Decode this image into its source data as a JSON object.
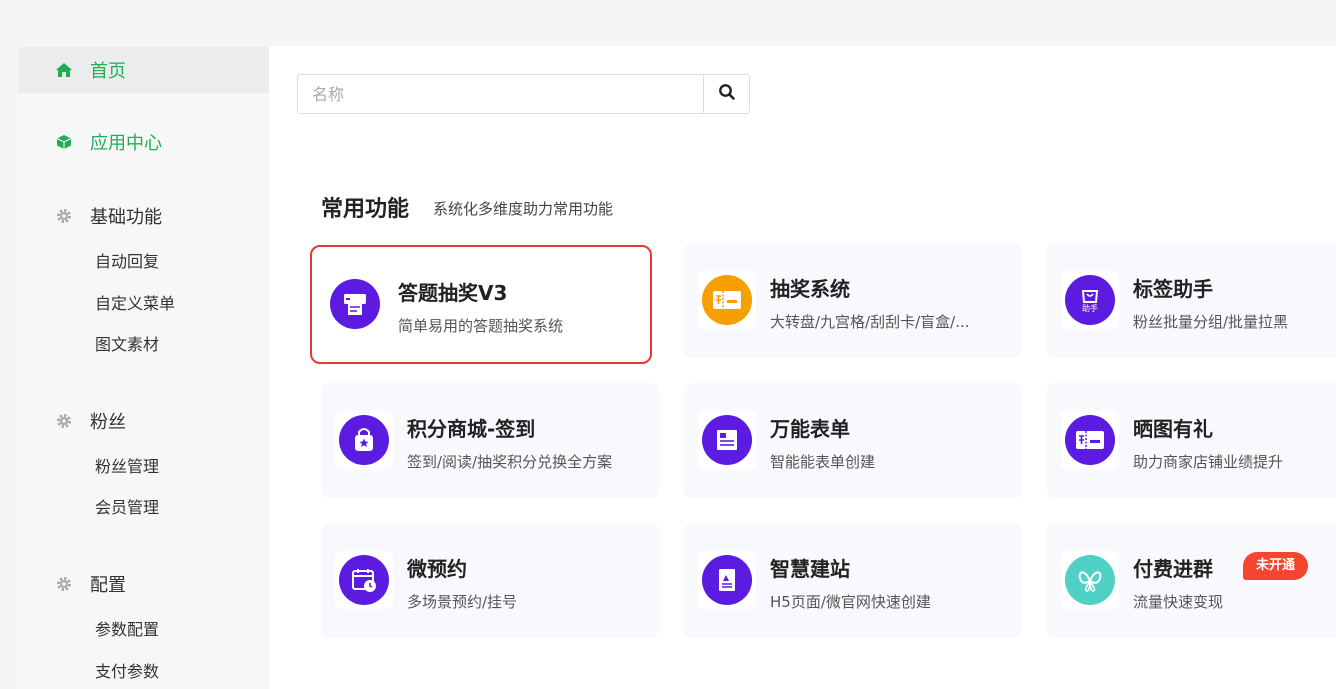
{
  "sidebar": {
    "home": {
      "label": "首页",
      "icon": "home-icon"
    },
    "app_center": {
      "label": "应用中心",
      "icon": "cube-icon"
    },
    "groups": [
      {
        "label": "基础功能",
        "icon": "gear-icon",
        "items": [
          "自动回复",
          "自定义菜单",
          "图文素材"
        ]
      },
      {
        "label": "粉丝",
        "icon": "gear-icon",
        "items": [
          "粉丝管理",
          "会员管理"
        ]
      },
      {
        "label": "配置",
        "icon": "gear-icon",
        "items": [
          "参数配置",
          "支付参数"
        ]
      }
    ]
  },
  "search": {
    "placeholder": "名称",
    "value": ""
  },
  "section": {
    "title": "常用功能",
    "subtitle": "系统化多维度助力常用功能"
  },
  "cards": [
    {
      "title": "答题抽奖V3",
      "desc": "简单易用的答题抽奖系统",
      "icon": "printer-quiz-icon",
      "color": "#5b1be0"
    },
    {
      "title": "抽奖系统",
      "desc": "大转盘/九宫格/刮刮卡/盲盒/...",
      "icon": "gift-ticket-icon",
      "color": "#f5a000"
    },
    {
      "title": "标签助手",
      "desc": "粉丝批量分组/批量拉黑",
      "icon": "bag-helper-icon",
      "color": "#5b1be0",
      "icon_text": "助手"
    },
    {
      "title": "积分商城-签到",
      "desc": "签到/阅读/抽奖积分兑换全方案",
      "icon": "shopping-bag-star-icon",
      "color": "#5b1be0"
    },
    {
      "title": "万能表单",
      "desc": "智能能表单创建",
      "icon": "form-icon",
      "color": "#5b1be0"
    },
    {
      "title": "晒图有礼",
      "desc": "助力商家店铺业绩提升",
      "icon": "gift-ticket-icon",
      "color": "#5b1be0"
    },
    {
      "title": "微预约",
      "desc": "多场景预约/挂号",
      "icon": "calendar-clock-icon",
      "color": "#5b1be0"
    },
    {
      "title": "智慧建站",
      "desc": "H5页面/微官网快速创建",
      "icon": "document-image-icon",
      "color": "#5b1be0"
    },
    {
      "title": "付费进群",
      "desc": "流量快速变现",
      "icon": "butterfly-icon",
      "color": "#4fd1c5",
      "badge": "未开通"
    }
  ]
}
